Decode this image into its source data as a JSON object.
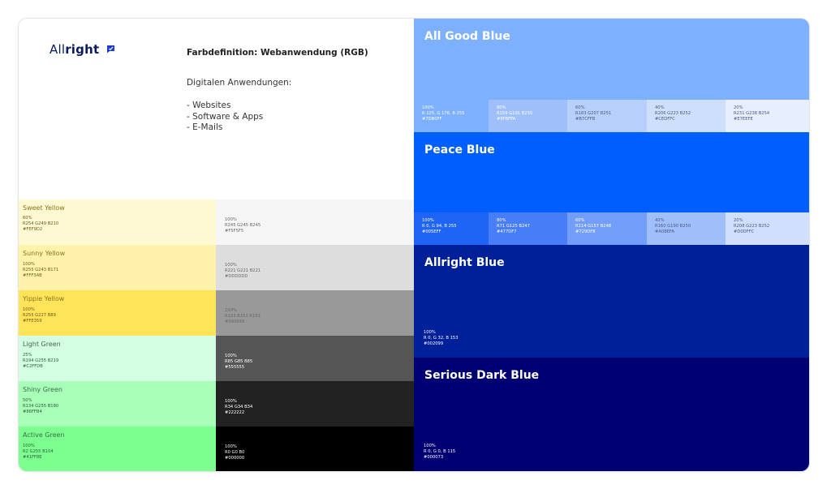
{
  "brand": {
    "name_regular": "All",
    "name_bold": "right"
  },
  "intro": {
    "heading": "Farbdefinition: Webanwendung (RGB)",
    "subtitle": "Digitalen Anwendungen:",
    "uses": [
      "- Websites",
      "- Software & Apps",
      "- E-Mails"
    ]
  },
  "left_swatches": [
    {
      "name": "Sweet Yellow",
      "lines": [
        "60%",
        "R254 G249 B210",
        "#FEF9D2"
      ],
      "color": "#FEF9D2"
    },
    {
      "name": "Sunny Yellow",
      "lines": [
        "100%",
        "R255 G243 B171",
        "#FFF3AB"
      ],
      "color": "#FFF3AB"
    },
    {
      "name": "Yippie Yellow",
      "lines": [
        "100%",
        "R255 G227 B89",
        "#FFE359"
      ],
      "color": "#FFE359"
    },
    {
      "name": "Light Green",
      "lines": [
        "25%",
        "R194 G255 B219",
        "#C2FFDB"
      ],
      "color": "#D5FFE2"
    },
    {
      "name": "Shiny Green",
      "lines": [
        "50%",
        "R134 G255 B180",
        "#86FFB4"
      ],
      "color": "#A8FFB8"
    },
    {
      "name": "Active Green",
      "lines": [
        "100%",
        "R2 G255 B104",
        "#41FF8E"
      ],
      "color": "#7CFF8E"
    }
  ],
  "grey_swatches": [
    {
      "lines": [
        "100%",
        "R245 G245 B245",
        "#F5F5F5"
      ],
      "color": "#F5F5F5"
    },
    {
      "lines": [
        "100%",
        "R221 G221 B221",
        "#DDDDDD"
      ],
      "color": "#DDDDDD"
    },
    {
      "lines": [
        "100%",
        "R153 R153 R153",
        "#999999"
      ],
      "color": "#999999"
    },
    {
      "lines": [
        "100%",
        "R85 G85 B85",
        "#555555"
      ],
      "color": "#555555"
    },
    {
      "lines": [
        "100%",
        "R34 G34 B34",
        "#222222"
      ],
      "color": "#222222"
    },
    {
      "lines": [
        "100%",
        "R0 G0 B0",
        "#000000"
      ],
      "color": "#000000"
    }
  ],
  "blue_sections": [
    {
      "name": "All Good Blue",
      "color": "#7DB0FF",
      "tints": [
        {
          "lines": [
            "100%",
            "R 125, G 176, B 255",
            "#7DB0FF"
          ],
          "color": "#7DB0FF"
        },
        {
          "lines": [
            "80%",
            "R159 G191 B250",
            "#9FBFFA"
          ],
          "color": "#9FBFFA"
        },
        {
          "lines": [
            "60%",
            "R183 G207 B251",
            "#B7CFFB"
          ],
          "color": "#B7CFFB"
        },
        {
          "lines": [
            "40%",
            "R206 G223 B252",
            "#CEDFFC"
          ],
          "color": "#CEDFFC"
        },
        {
          "lines": [
            "20%",
            "R231 G238 B254",
            "#E7EEFE"
          ],
          "color": "#E7EEFE"
        }
      ]
    },
    {
      "name": "Peace Blue",
      "color": "#005EFF",
      "tints": [
        {
          "lines": [
            "100%",
            "R 0, G 94, B 255",
            "#005EFF"
          ],
          "color": "#1E64F5"
        },
        {
          "lines": [
            "80%",
            "R71 G125 B247",
            "#477DF7"
          ],
          "color": "#477DF7"
        },
        {
          "lines": [
            "60%",
            "R114 G157 B248",
            "#729DF8"
          ],
          "color": "#729DF8"
        },
        {
          "lines": [
            "40%",
            "R160 G190 B250",
            "#A0BEFA"
          ],
          "color": "#A0BEFA"
        },
        {
          "lines": [
            "20%",
            "R208 G223 B252",
            "#D0DFFC"
          ],
          "color": "#D0DFFC"
        }
      ]
    },
    {
      "name": "Allright Blue",
      "lines": [
        "100%",
        "R 0, G 32, B 153",
        "#002099"
      ],
      "color": "#002099"
    },
    {
      "name": "Serious Dark Blue",
      "lines": [
        "100%",
        "R 0, G 0,  B 115",
        "#000073"
      ],
      "color": "#000073"
    }
  ]
}
